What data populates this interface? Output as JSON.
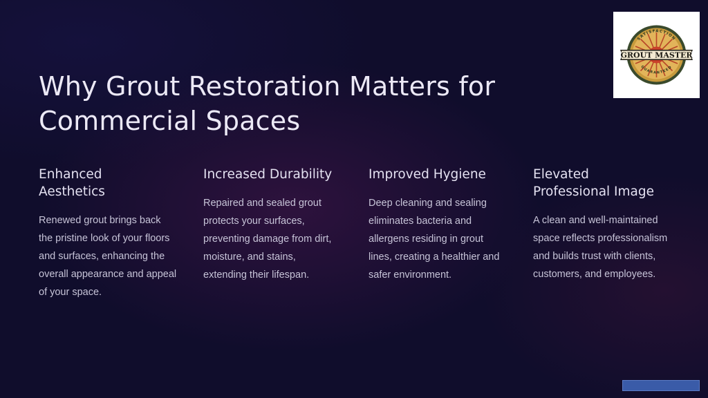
{
  "slide": {
    "title_lines": [
      "Why Grout Restoration Matters for",
      "Commercial Spaces"
    ],
    "columns": [
      {
        "heading_lines": [
          "Enhanced",
          "Aesthetics"
        ],
        "body": "Renewed grout brings back the pristine look of your floors and surfaces, enhancing the overall appearance and appeal of your space."
      },
      {
        "heading_lines": [
          "Increased Durability"
        ],
        "body": "Repaired and sealed grout protects your surfaces, preventing damage from dirt, moisture, and stains, extending their lifespan."
      },
      {
        "heading_lines": [
          "Improved Hygiene"
        ],
        "body": "Deep cleaning and sealing eliminates bacteria and allergens residing in grout lines, creating a healthier and safer environment."
      },
      {
        "heading_lines": [
          "Elevated",
          "Professional Image"
        ],
        "body": "A clean and well-maintained space reflects professionalism and builds trust with clients, customers, and employees."
      }
    ]
  },
  "logo": {
    "brand": "GROUT MASTER",
    "top_arc": "SATISFACTION",
    "bottom_arc": "GUARANTEED",
    "colors": {
      "ring": "#3a4a2c",
      "gold": "#c79a3c",
      "red": "#b0321f",
      "banner": "#1d1a14"
    }
  },
  "colors": {
    "background": "#100d2c",
    "title": "#ece9f6",
    "body": "#c7c4d8",
    "corner_button": "#3a5ba8"
  }
}
